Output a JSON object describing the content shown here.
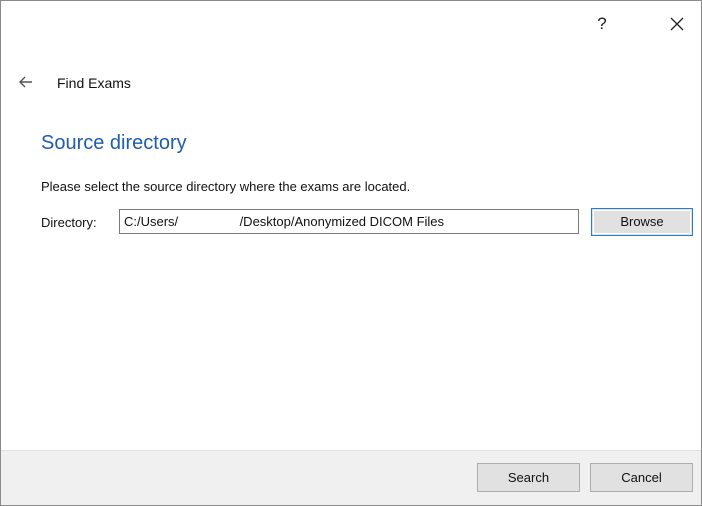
{
  "title_bar": {
    "help_label": "?",
    "close_icon": "close-icon"
  },
  "nav": {
    "back_icon": "back-arrow-icon",
    "title": "Find Exams"
  },
  "content": {
    "heading": "Source directory",
    "instruction": "Please select the source directory where the exams are located.",
    "directory_label": "Directory:",
    "directory_value": "C:/Users/                 /Desktop/Anonymized DICOM Files",
    "browse_label": "Browse"
  },
  "footer": {
    "search_label": "Search",
    "cancel_label": "Cancel"
  },
  "colors": {
    "heading": "#1f5cad",
    "focus_border": "#2a7ad7",
    "footer_bg": "#f0f0f0"
  }
}
